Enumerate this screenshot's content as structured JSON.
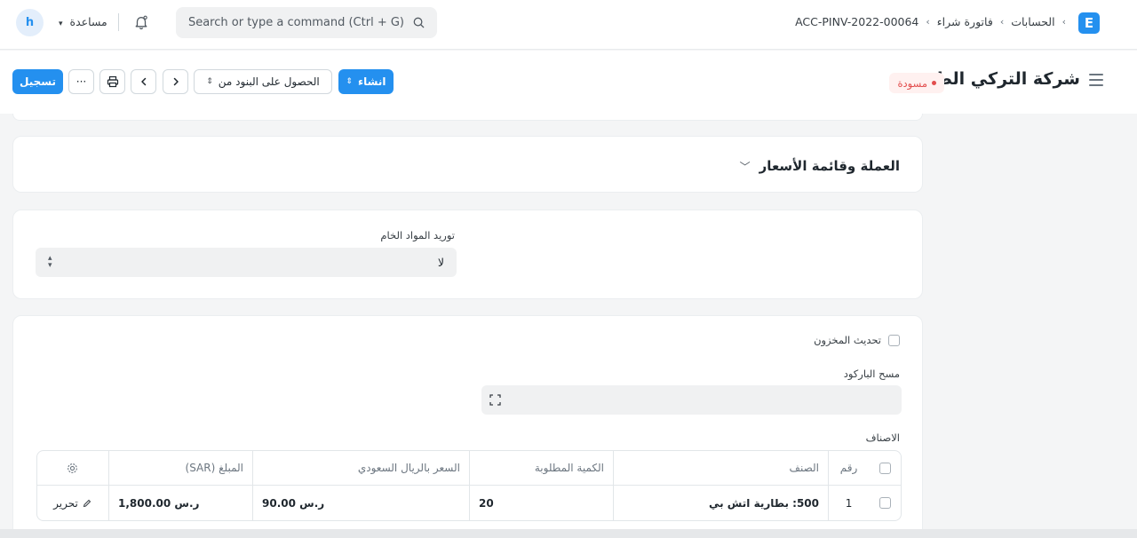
{
  "navbar": {
    "logo": "E",
    "breadcrumbs": [
      "الحسابات",
      "فاتورة شراء",
      "ACC-PINV-2022-00064"
    ],
    "search_placeholder": "Search or type a command (Ctrl + G)",
    "help_label": "مساعدة",
    "avatar_letter": "h"
  },
  "page": {
    "title": "شركة التركي الطبية",
    "status": "مسودة",
    "buttons": {
      "create": "انشاء",
      "get_items": "الحصول على البنود من",
      "more": "···",
      "submit": "تسجيل"
    }
  },
  "sections": {
    "currency": {
      "title": "العملة وقائمة الأسعار"
    },
    "raw_materials": {
      "label": "توريد المواد الخام",
      "value": "لا"
    },
    "items": {
      "update_stock_label": "تحديث المخزون",
      "barcode_label": "مسح الباركود",
      "table_label": "الاصناف"
    }
  },
  "table": {
    "headers": {
      "no": "رقم",
      "item": "الصنف",
      "qty": "الكمية المطلوبة",
      "rate": "السعر بالريال السعودي",
      "amount": "المبلغ (SAR)"
    },
    "rows": [
      {
        "no": "1",
        "item": "500: بطارية اتش بي",
        "qty": "20",
        "rate": "ر.س 90.00",
        "amount": "ر.س 1,800.00",
        "edit": "تحرير"
      }
    ]
  },
  "colors": {
    "accent": "#2490ef",
    "draft": "#e24c4c"
  }
}
